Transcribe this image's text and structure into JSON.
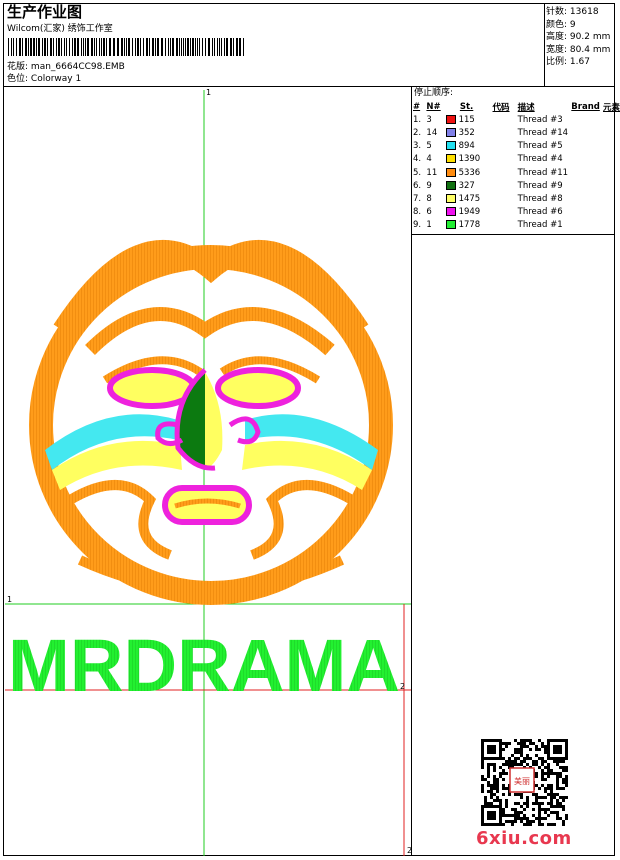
{
  "header": {
    "title": "生产作业图",
    "company": "Wilcom(汇家) 绣饰工作室",
    "design_label": "花版:",
    "design_value": "man_6664CC98.EMB",
    "colorway_label": "色位:",
    "colorway_value": "Colorway 1"
  },
  "stats": [
    {
      "label": "针数:",
      "value": "13618"
    },
    {
      "label": "颜色:",
      "value": "9"
    },
    {
      "label": "高度:",
      "value": "90.2 mm"
    },
    {
      "label": "宽度:",
      "value": "80.4 mm"
    },
    {
      "label": "比例:",
      "value": "1.67"
    }
  ],
  "sequence": {
    "title": "停止顺序:",
    "columns": [
      "#",
      "N#",
      "St.",
      "代码",
      "描述",
      "Brand",
      "元素"
    ],
    "rows": [
      {
        "idx": "1.",
        "n": "3",
        "color": "#ee1111",
        "st": "115",
        "desc": "Thread #3"
      },
      {
        "idx": "2.",
        "n": "14",
        "color": "#8080e8",
        "st": "352",
        "desc": "Thread #14"
      },
      {
        "idx": "3.",
        "n": "5",
        "color": "#22e0f0",
        "st": "894",
        "desc": "Thread #5"
      },
      {
        "idx": "4.",
        "n": "4",
        "color": "#ffe000",
        "st": "1390",
        "desc": "Thread #4"
      },
      {
        "idx": "5.",
        "n": "11",
        "color": "#ff8c10",
        "st": "5336",
        "desc": "Thread #11"
      },
      {
        "idx": "6.",
        "n": "9",
        "color": "#107010",
        "st": "327",
        "desc": "Thread #9"
      },
      {
        "idx": "7.",
        "n": "8",
        "color": "#ffff66",
        "st": "1475",
        "desc": "Thread #8"
      },
      {
        "idx": "8.",
        "n": "6",
        "color": "#ee10ee",
        "st": "1949",
        "desc": "Thread #6"
      },
      {
        "idx": "9.",
        "n": "1",
        "color": "#22ee33",
        "st": "1778",
        "desc": "Thread #1"
      }
    ]
  },
  "design": {
    "text": "MRDRAMA",
    "guide_labels": [
      "1",
      "1",
      "2",
      "2"
    ],
    "colors": {
      "orange": "#ff9c1a",
      "green_text": "#22f030",
      "magenta": "#ee22dd",
      "cyan": "#44e8f0",
      "yellow": "#ffff60",
      "dark_green": "#0c7a10",
      "guide_green": "#22cc22",
      "guide_red": "#e02020"
    }
  },
  "footer": {
    "site": "6xiu.com",
    "qr_stamp": "美丽"
  }
}
